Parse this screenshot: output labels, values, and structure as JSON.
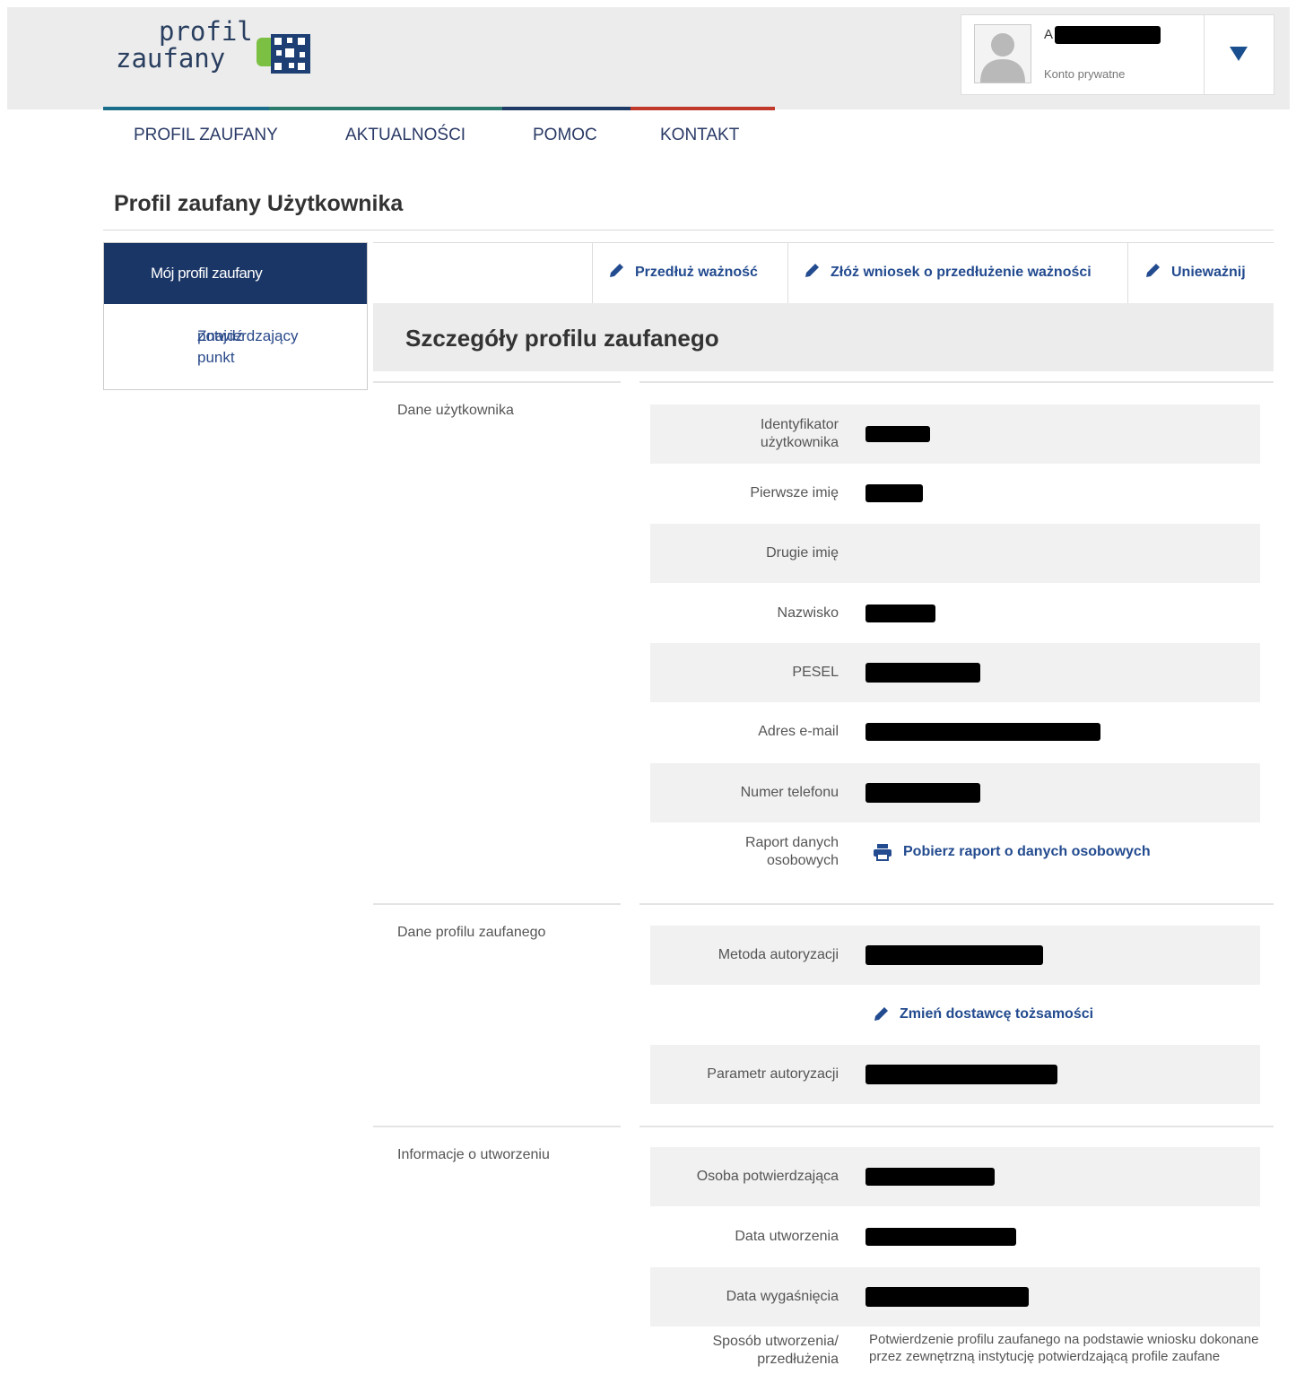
{
  "header": {
    "logo_line1": "profil",
    "logo_line2": "zaufany",
    "user_name": "A",
    "account_type": "Konto prywatne"
  },
  "nav": [
    "PROFIL ZAUFANY",
    "AKTUALNOŚCI",
    "POMOC",
    "KONTAKT"
  ],
  "page_title": "Profil zaufany Użytkownika",
  "sidebar": {
    "active": "Mój profil zaufany",
    "other_line1": "Znajdź punkt",
    "other_line2": "potwierdzający"
  },
  "actions": [
    "Przedłuż ważność",
    "Złóż wniosek o przedłużenie ważności",
    "Unieważnij"
  ],
  "section_title": "Szczegóły profilu zaufanego",
  "groups": {
    "user_data": "Dane użytkownika",
    "profile_data": "Dane profilu zaufanego",
    "creation_info": "Informacje o utworzeniu"
  },
  "fields": {
    "user_id_l1": "Identyfikator",
    "user_id_l2": "użytkownika",
    "first_name": "Pierwsze imię",
    "second_name": "Drugie imię",
    "surname": "Nazwisko",
    "pesel": "PESEL",
    "email": "Adres e-mail",
    "phone": "Numer telefonu",
    "report_l1": "Raport danych",
    "report_l2": "osobowych",
    "report_link": "Pobierz raport o danych osobowych",
    "auth_method": "Metoda autoryzacji",
    "change_provider": "Zmień dostawcę tożsamości",
    "auth_param": "Parametr autoryzacji",
    "confirming_person": "Osoba potwierdzająca",
    "created_date": "Data utworzenia",
    "expiry_date": "Data wygaśnięcia",
    "method_l1": "Sposób utworzenia/",
    "method_l2": "przedłużenia",
    "method_value": "Potwierdzenie profilu zaufanego na podstawie wniosku dokonane przez zewnętrzną instytucję potwierdzającą profile zaufane"
  },
  "colors": {
    "nav_line": [
      "#1a6e8a",
      "#2a7a6e",
      "#1f3a66",
      "#c0392b"
    ],
    "brand_blue": "#1a3666",
    "link_blue": "#234b8f"
  },
  "icons": [
    "user-silhouette-icon",
    "chevron-down-icon",
    "pencil-icon",
    "printer-icon",
    "logo-mark-icon"
  ]
}
